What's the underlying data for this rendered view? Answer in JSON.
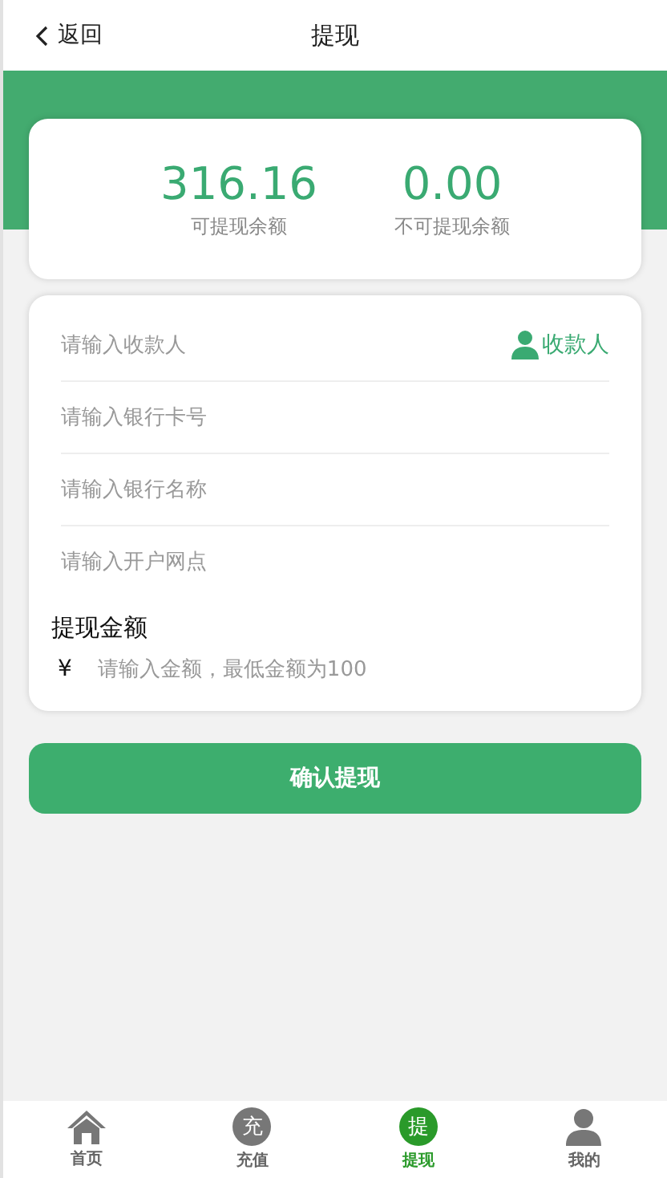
{
  "header": {
    "back": "返回",
    "title": "提现"
  },
  "balances": [
    {
      "amount": "316.16",
      "label": "可提现余额"
    },
    {
      "amount": "0.00",
      "label": "不可提现余额"
    }
  ],
  "fields": [
    {
      "placeholder": "请输入收款人",
      "action": "收款人"
    },
    {
      "placeholder": "请输入银行卡号"
    },
    {
      "placeholder": "请输入银行名称"
    },
    {
      "placeholder": "请输入开户网点"
    }
  ],
  "amount": {
    "label": "提现金额",
    "currency": "¥",
    "placeholder": "请输入金额，最低金额为100"
  },
  "submit": "确认提现",
  "tabs": [
    {
      "kind": "home",
      "label": "首页",
      "selected": false
    },
    {
      "kind": "glyph",
      "glyph": "充",
      "label": "充值",
      "selected": false
    },
    {
      "kind": "glyph",
      "glyph": "提",
      "label": "提现",
      "selected": true
    },
    {
      "kind": "person",
      "label": "我的",
      "selected": false
    }
  ]
}
